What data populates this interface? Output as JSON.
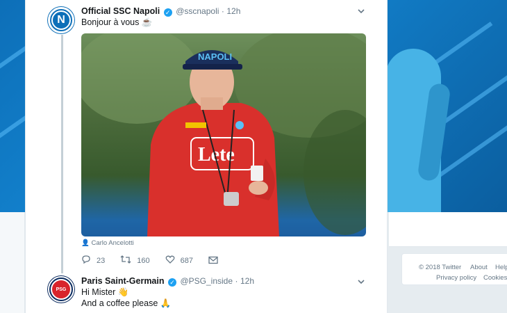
{
  "tweets": [
    {
      "name": "Official SSC Napoli",
      "handle": "@sscnapoli",
      "time": "12h",
      "separator": "·",
      "text": "Bonjour à vous ☕",
      "photo_credit": "Carlo Ancelotti",
      "actions": {
        "replies": "23",
        "retweets": "160",
        "likes": "687"
      }
    },
    {
      "name": "Paris Saint-Germain",
      "handle": "@PSG_inside",
      "time": "12h",
      "separator": "·",
      "line1": "Hi Mister 👋",
      "line2": "And a coffee please 🙏"
    }
  ],
  "footer": {
    "copyright": "© 2018 Twitter",
    "about": "About",
    "help": "Help",
    "privacy": "Privacy policy",
    "cookies": "Cookies"
  },
  "icons": {
    "napoli_avatar": "napoli-logo",
    "psg_avatar": "psg-logo",
    "verified": "verified-badge",
    "reply": "reply-icon",
    "retweet": "retweet-icon",
    "like": "heart-icon",
    "dm": "envelope-icon"
  },
  "colors": {
    "accent": "#1da1f2",
    "napoli_blue": "#0d6fb8",
    "psg_navy": "#0a2a5e"
  }
}
